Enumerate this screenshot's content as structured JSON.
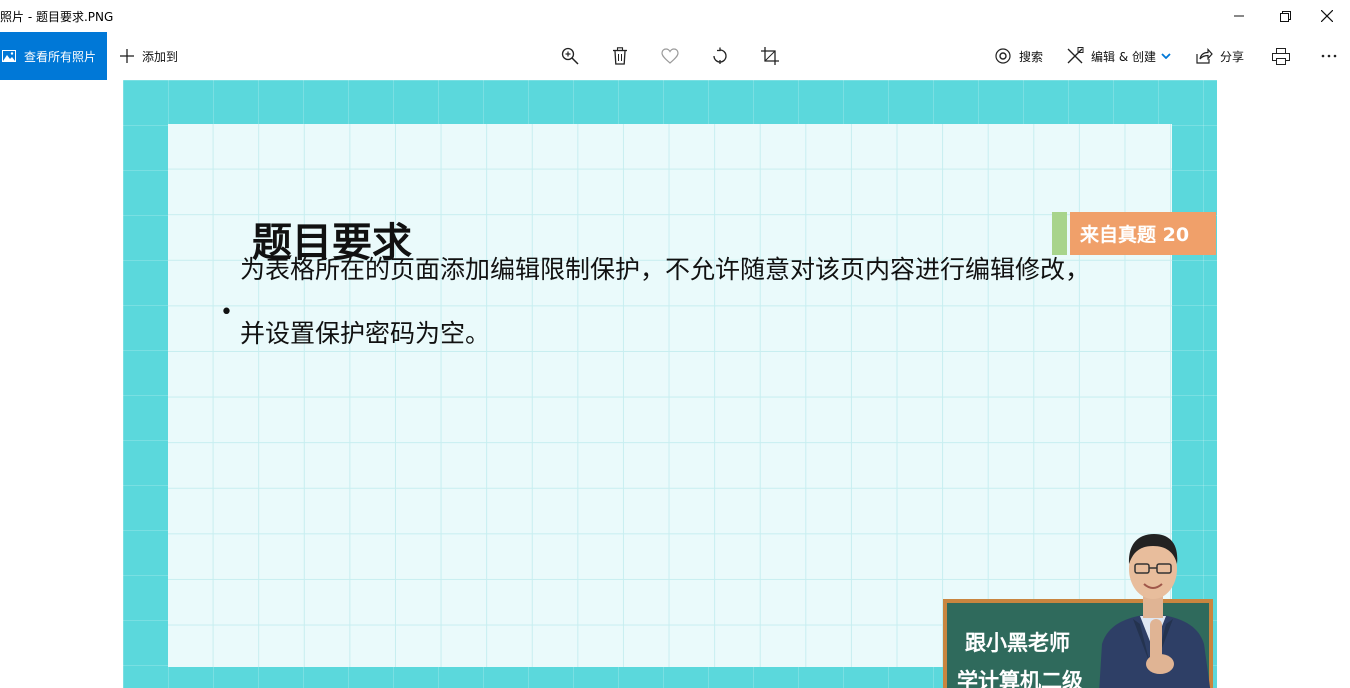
{
  "window": {
    "title": "照片 - 题目要求.PNG",
    "minimize_icon": "minimize-icon",
    "restore_icon": "restore-icon",
    "close_icon": "close-icon"
  },
  "toolbar": {
    "view_all_label": "查看所有照片",
    "add_to_label": "添加到",
    "search_label": "搜索",
    "edit_create_label": "编辑 & 创建",
    "share_label": "分享",
    "icons": [
      "zoom-in-icon",
      "delete-icon",
      "favorite-icon",
      "rotate-icon",
      "crop-icon",
      "print-icon",
      "more-icon"
    ]
  },
  "slide": {
    "title": "题目要求",
    "tag": "来自真题 20",
    "bullet_symbol": "•",
    "body_line1": "为表格所在的页面添加编辑限制保护，不允许随意对该页内容进行编辑修改，",
    "body_line2": "并设置保护密码为空。",
    "board_line1": "跟小黑老师",
    "board_line2": "学计算机二级",
    "colors": {
      "frame": "#5bd8dc",
      "paper": "#eafafb",
      "tag": "#f0a06a",
      "tag_bar": "#a8d48b",
      "board": "#2f6a5c",
      "board_border": "#c9853f",
      "accent": "#0078d7"
    }
  }
}
